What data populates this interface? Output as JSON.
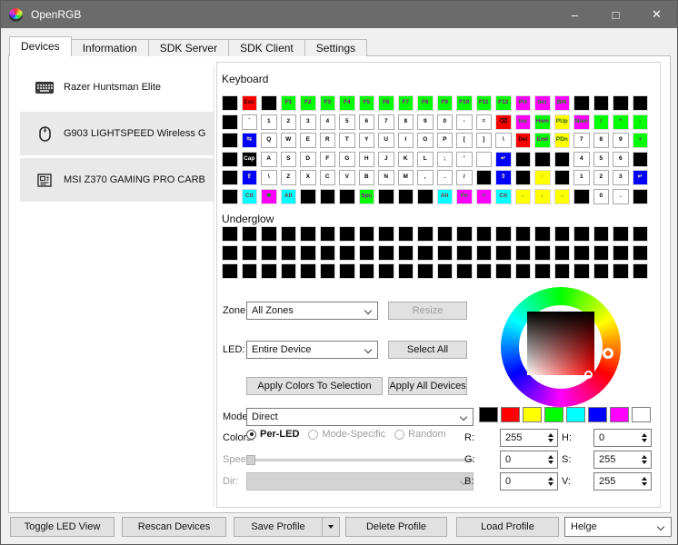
{
  "window": {
    "title": "OpenRGB",
    "controls": {
      "minimize": "–",
      "maximize": "□",
      "close": "✕"
    }
  },
  "tabs": [
    {
      "label": "Devices",
      "active": true
    },
    {
      "label": "Information",
      "active": false
    },
    {
      "label": "SDK Server",
      "active": false
    },
    {
      "label": "SDK Client",
      "active": false
    },
    {
      "label": "Settings",
      "active": false
    }
  ],
  "devices": [
    {
      "name": "Razer Huntsman Elite",
      "icon": "keyboard-icon",
      "selected": true
    },
    {
      "name": "G903 LIGHTSPEED Wireless G",
      "icon": "mouse-icon",
      "selected": false
    },
    {
      "name": "MSI Z370 GAMING PRO CARB",
      "icon": "motherboard-icon",
      "selected": false
    }
  ],
  "device_view": {
    "keyboard_label": "Keyboard",
    "underglow_label": "Underglow",
    "underglow": {
      "rows": 3,
      "cols": 22
    },
    "key_palette": {
      "K": {
        "bg": "#000000",
        "fg": "#ffffff",
        "border": "#d9d9d9"
      },
      "W": {
        "bg": "#ffffff",
        "fg": "#000000",
        "border": "#a8a8a8"
      },
      "R": {
        "bg": "#ff0000",
        "fg": "#1a0505",
        "border": "#d9d9d9"
      },
      "G": {
        "bg": "#00ff00",
        "fg": "#9b009b",
        "border": "#d9d9d9"
      },
      "Y": {
        "bg": "#ffff00",
        "fg": "#1d5c1d",
        "border": "#d9d9d9"
      },
      "C": {
        "bg": "#00ffff",
        "fg": "#8c2f2f",
        "border": "#d9d9d9"
      },
      "M": {
        "bg": "#ff00ff",
        "fg": "#00a000",
        "border": "#d9d9d9"
      },
      "B": {
        "bg": "#0000ff",
        "fg": "#ffee88",
        "border": "#d9d9d9"
      }
    },
    "key_rows": [
      [
        [
          "",
          "K"
        ],
        [
          "Esc",
          "R"
        ],
        [
          "",
          "K"
        ],
        [
          "F1",
          "G"
        ],
        [
          "F2",
          "G"
        ],
        [
          "F3",
          "G"
        ],
        [
          "F4",
          "G"
        ],
        [
          "F5",
          "G"
        ],
        [
          "F6",
          "G"
        ],
        [
          "F7",
          "G"
        ],
        [
          "F8",
          "G"
        ],
        [
          "F9",
          "G"
        ],
        [
          "F10",
          "G"
        ],
        [
          "F11",
          "G"
        ],
        [
          "F12",
          "G"
        ],
        [
          "Prt",
          "M"
        ],
        [
          "Scr",
          "M"
        ],
        [
          "Brk",
          "M"
        ],
        [
          "",
          "K"
        ],
        [
          "",
          "K"
        ],
        [
          "",
          "K"
        ],
        [
          "",
          "K"
        ]
      ],
      [
        [
          "",
          "K"
        ],
        [
          "`",
          "W"
        ],
        [
          "1",
          "W"
        ],
        [
          "2",
          "W"
        ],
        [
          "3",
          "W"
        ],
        [
          "4",
          "W"
        ],
        [
          "5",
          "W"
        ],
        [
          "6",
          "W"
        ],
        [
          "7",
          "W"
        ],
        [
          "8",
          "W"
        ],
        [
          "9",
          "W"
        ],
        [
          "0",
          "W"
        ],
        [
          "-",
          "W"
        ],
        [
          "=",
          "W"
        ],
        [
          "⌫",
          "R"
        ],
        [
          "Ins",
          "M"
        ],
        [
          "Hom",
          "G"
        ],
        [
          "PUp",
          "Y"
        ],
        [
          "Num",
          "M"
        ],
        [
          "/",
          "G"
        ],
        [
          "*",
          "G"
        ],
        [
          "-",
          "G"
        ]
      ],
      [
        [
          "",
          "K"
        ],
        [
          "⇆",
          "B"
        ],
        [
          "Q",
          "W"
        ],
        [
          "W",
          "W"
        ],
        [
          "E",
          "W"
        ],
        [
          "R",
          "W"
        ],
        [
          "T",
          "W"
        ],
        [
          "Y",
          "W"
        ],
        [
          "U",
          "W"
        ],
        [
          "I",
          "W"
        ],
        [
          "O",
          "W"
        ],
        [
          "P",
          "W"
        ],
        [
          "[",
          "W"
        ],
        [
          "]",
          "W"
        ],
        [
          "\\",
          "W"
        ],
        [
          "Del",
          "R"
        ],
        [
          "End",
          "G"
        ],
        [
          "PDn",
          "Y"
        ],
        [
          "7",
          "W"
        ],
        [
          "8",
          "W"
        ],
        [
          "9",
          "W"
        ],
        [
          "+",
          "G"
        ]
      ],
      [
        [
          "",
          "K"
        ],
        [
          "Cap",
          "K"
        ],
        [
          "A",
          "W"
        ],
        [
          "S",
          "W"
        ],
        [
          "D",
          "W"
        ],
        [
          "F",
          "W"
        ],
        [
          "G",
          "W"
        ],
        [
          "H",
          "W"
        ],
        [
          "J",
          "W"
        ],
        [
          "K",
          "W"
        ],
        [
          "L",
          "W"
        ],
        [
          ";",
          "W"
        ],
        [
          "'",
          "W"
        ],
        [
          "",
          "W"
        ],
        [
          "↵",
          "B"
        ],
        [
          "",
          "K"
        ],
        [
          "",
          "K"
        ],
        [
          "",
          "K"
        ],
        [
          "4",
          "W"
        ],
        [
          "5",
          "W"
        ],
        [
          "6",
          "W"
        ],
        [
          "",
          "K"
        ]
      ],
      [
        [
          "",
          "K"
        ],
        [
          "⇧",
          "B"
        ],
        [
          "\\",
          "W"
        ],
        [
          "Z",
          "W"
        ],
        [
          "X",
          "W"
        ],
        [
          "C",
          "W"
        ],
        [
          "V",
          "W"
        ],
        [
          "B",
          "W"
        ],
        [
          "N",
          "W"
        ],
        [
          "M",
          "W"
        ],
        [
          ",",
          "W"
        ],
        [
          ".",
          "W"
        ],
        [
          "/",
          "W"
        ],
        [
          "",
          "K"
        ],
        [
          "⇧",
          "B"
        ],
        [
          "",
          "K"
        ],
        [
          "↑",
          "Y"
        ],
        [
          "",
          "K"
        ],
        [
          "1",
          "W"
        ],
        [
          "2",
          "W"
        ],
        [
          "3",
          "W"
        ],
        [
          "↵",
          "B"
        ]
      ],
      [
        [
          "",
          "K"
        ],
        [
          "Ctl",
          "C"
        ],
        [
          "❖",
          "M"
        ],
        [
          "Alt",
          "C"
        ],
        [
          "",
          "K"
        ],
        [
          "",
          "K"
        ],
        [
          "",
          "K"
        ],
        [
          "Spc",
          "G"
        ],
        [
          "",
          "K"
        ],
        [
          "",
          "K"
        ],
        [
          "",
          "K"
        ],
        [
          "Alt",
          "C"
        ],
        [
          "Fn",
          "M"
        ],
        [
          "≡",
          "M"
        ],
        [
          "Ctl",
          "C"
        ],
        [
          "←",
          "Y"
        ],
        [
          "↓",
          "Y"
        ],
        [
          "→",
          "Y"
        ],
        [
          "",
          "K"
        ],
        [
          "0",
          "W"
        ],
        [
          ".",
          "W"
        ],
        [
          "",
          "K"
        ]
      ]
    ]
  },
  "controls": {
    "zone": {
      "label": "Zone:",
      "value": "All Zones"
    },
    "resize_label": "Resize",
    "led": {
      "label": "LED:",
      "value": "Entire Device"
    },
    "select_all_label": "Select All",
    "apply_selection_label": "Apply Colors To Selection",
    "apply_all_label": "Apply All Devices",
    "mode": {
      "label": "Mode:",
      "value": "Direct"
    },
    "colors_label": "Colors:",
    "radios": {
      "per_led": {
        "label": "Per-LED",
        "checked": true,
        "disabled": false
      },
      "mode_specific": {
        "label": "Mode-Specific",
        "checked": false,
        "disabled": true
      },
      "random": {
        "label": "Random",
        "checked": false,
        "disabled": true
      }
    },
    "speed_label": "Speed:",
    "dir_label": "Dir:",
    "r": {
      "label": "R:",
      "value": "255"
    },
    "g": {
      "label": "G:",
      "value": "0"
    },
    "b": {
      "label": "B:",
      "value": "0"
    },
    "h": {
      "label": "H:",
      "value": "0"
    },
    "s": {
      "label": "S:",
      "value": "255"
    },
    "v": {
      "label": "V:",
      "value": "255"
    },
    "swatches": [
      "#000000",
      "#ff0000",
      "#ffff00",
      "#00ff00",
      "#00ffff",
      "#0000ff",
      "#ff00ff",
      "#ffffff"
    ],
    "picker": {
      "selected_color": "#ff0000",
      "hue": 0
    }
  },
  "footer": {
    "toggle_led_view": "Toggle LED View",
    "rescan_devices": "Rescan Devices",
    "save_profile": "Save Profile",
    "delete_profile": "Delete Profile",
    "load_profile": "Load Profile",
    "profile_value": "Helge"
  }
}
